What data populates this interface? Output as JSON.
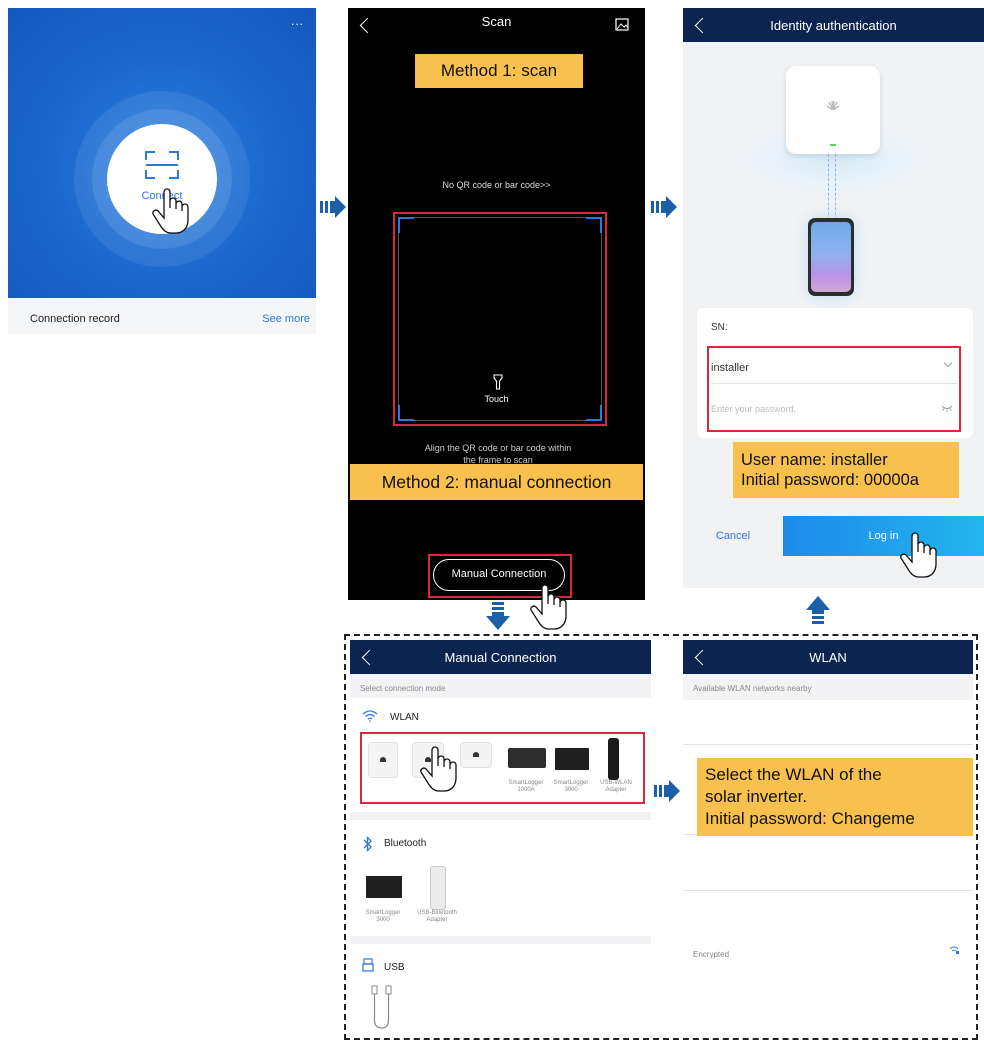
{
  "home": {
    "menu_dots": "...",
    "connect_label": "Connect",
    "connection_record": "Connection record",
    "see_more": "See more"
  },
  "scan": {
    "title": "Scan",
    "method1": "Method 1: scan",
    "no_code": "No QR code or bar code>>",
    "touch": "Touch",
    "align_text": "Align the QR code or bar code within the frame to scan",
    "method2": "Method 2: manual connection",
    "manual_button": "Manual Connection"
  },
  "auth": {
    "title": "Identity authentication",
    "sn_label": "SN:",
    "username_value": "installer",
    "password_placeholder": "Enter your password.",
    "callout_line1": "User name: installer",
    "callout_line2": "Initial password: 00000a",
    "cancel": "Cancel",
    "login": "Log in"
  },
  "manual": {
    "title": "Manual Connection",
    "subtitle": "Select connection mode",
    "wlan": "WLAN",
    "bluetooth": "Bluetooth",
    "usb": "USB",
    "wlan_devices": [
      {
        "label": ""
      },
      {
        "label": ""
      },
      {
        "label": ""
      },
      {
        "label": "SmartLogger 1000A"
      },
      {
        "label": "SmartLogger 3000"
      },
      {
        "label": "USB-WLAN Adapter"
      }
    ],
    "bt_devices": [
      {
        "label": "SmartLogger 3000"
      },
      {
        "label": "USB-Bluetooth Adapter"
      }
    ]
  },
  "wlan_screen": {
    "title": "WLAN",
    "subtitle": "Available WLAN networks nearby",
    "callout_line1": "Select the WLAN of the",
    "callout_line2": "solar inverter.",
    "callout_line3": "Initial password: Changeme",
    "encrypted": "Encrypted"
  },
  "colors": {
    "navy": "#0c2550",
    "blue": "#1c6fd6",
    "callout": "#f8c14d",
    "red": "#d9283a",
    "login_gradient_start": "#1d8ae9",
    "login_gradient_end": "#22b6ee"
  }
}
